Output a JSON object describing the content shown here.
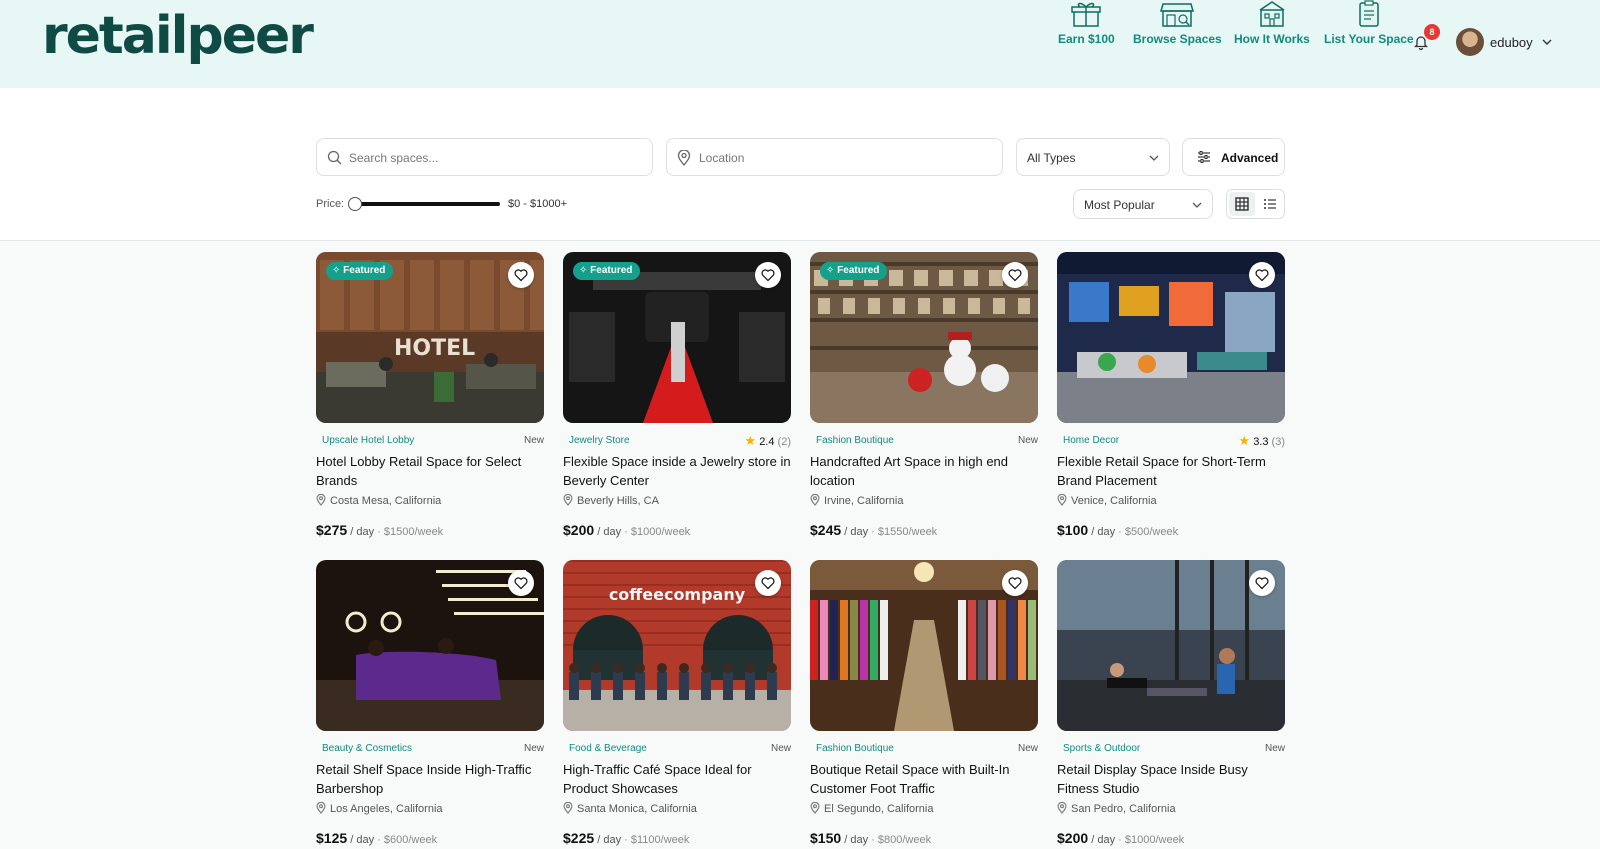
{
  "brand": {
    "name": "retailpeer",
    "accent": "#0f8c7d",
    "header_bg": "#e6f7f5",
    "logo_color": "#0f4a45"
  },
  "nav": [
    {
      "label": "Earn $100",
      "icon": "gift-icon"
    },
    {
      "label": "Browse Spaces",
      "icon": "storefront-icon"
    },
    {
      "label": "How It Works",
      "icon": "building-icon"
    },
    {
      "label": "List Your Space",
      "icon": "clipboard-icon"
    }
  ],
  "notifications": {
    "count": "8"
  },
  "user": {
    "name": "eduboy"
  },
  "filters": {
    "search_placeholder": "Search spaces...",
    "location_placeholder": "Location",
    "type_value": "All Types",
    "advanced_label": "Advanced",
    "price_label": "Price:",
    "price_range": "$0 - $1000+",
    "price_min_fraction": 0,
    "sort_value": "Most Popular"
  },
  "listings": [
    {
      "category": "Upscale Hotel Lobby",
      "status": "New",
      "featured": true,
      "title": "Hotel Lobby Retail Space for Select Brands",
      "location": "Costa Mesa, California",
      "price": "$275",
      "per": "/ day",
      "weekly": "· $1500/week"
    },
    {
      "category": "Jewelry Store",
      "rating": "2.4",
      "reviews": "(2)",
      "featured": true,
      "title": "Flexible Space inside a Jewelry store in Beverly Center",
      "location": "Beverly Hills, CA",
      "price": "$200",
      "per": "/ day",
      "weekly": "· $1000/week"
    },
    {
      "category": "Fashion Boutique",
      "status": "New",
      "featured": true,
      "title": "Handcrafted Art Space in high end location",
      "location": "Irvine, California",
      "price": "$245",
      "per": "/ day",
      "weekly": "· $1550/week"
    },
    {
      "category": "Home Decor",
      "rating": "3.3",
      "reviews": "(3)",
      "featured": false,
      "title": "Flexible Retail Space for Short-Term Brand Placement",
      "location": "Venice, California",
      "price": "$100",
      "per": "/ day",
      "weekly": "· $500/week"
    },
    {
      "category": "Beauty & Cosmetics",
      "status": "New",
      "featured": false,
      "title": "Retail Shelf Space Inside High-Traffic Barbershop",
      "location": "Los Angeles, California",
      "price": "$125",
      "per": "/ day",
      "weekly": "· $600/week"
    },
    {
      "category": "Food & Beverage",
      "status": "New",
      "featured": false,
      "title": "High-Traffic Café Space Ideal for Product Showcases",
      "location": "Santa Monica, California",
      "price": "$225",
      "per": "/ day",
      "weekly": "· $1100/week"
    },
    {
      "category": "Fashion Boutique",
      "status": "New",
      "featured": false,
      "title": "Boutique Retail Space with Built-In Customer Foot Traffic",
      "location": "El Segundo, California",
      "price": "$150",
      "per": "/ day",
      "weekly": "· $800/week"
    },
    {
      "category": "Sports & Outdoor",
      "status": "New",
      "featured": false,
      "title": "Retail Display Space Inside Busy Fitness Studio",
      "location": "San Pedro, California",
      "price": "$200",
      "per": "/ day",
      "weekly": "· $1000/week"
    }
  ],
  "featured_label": "Featured",
  "image_sign": "coffeecompany"
}
